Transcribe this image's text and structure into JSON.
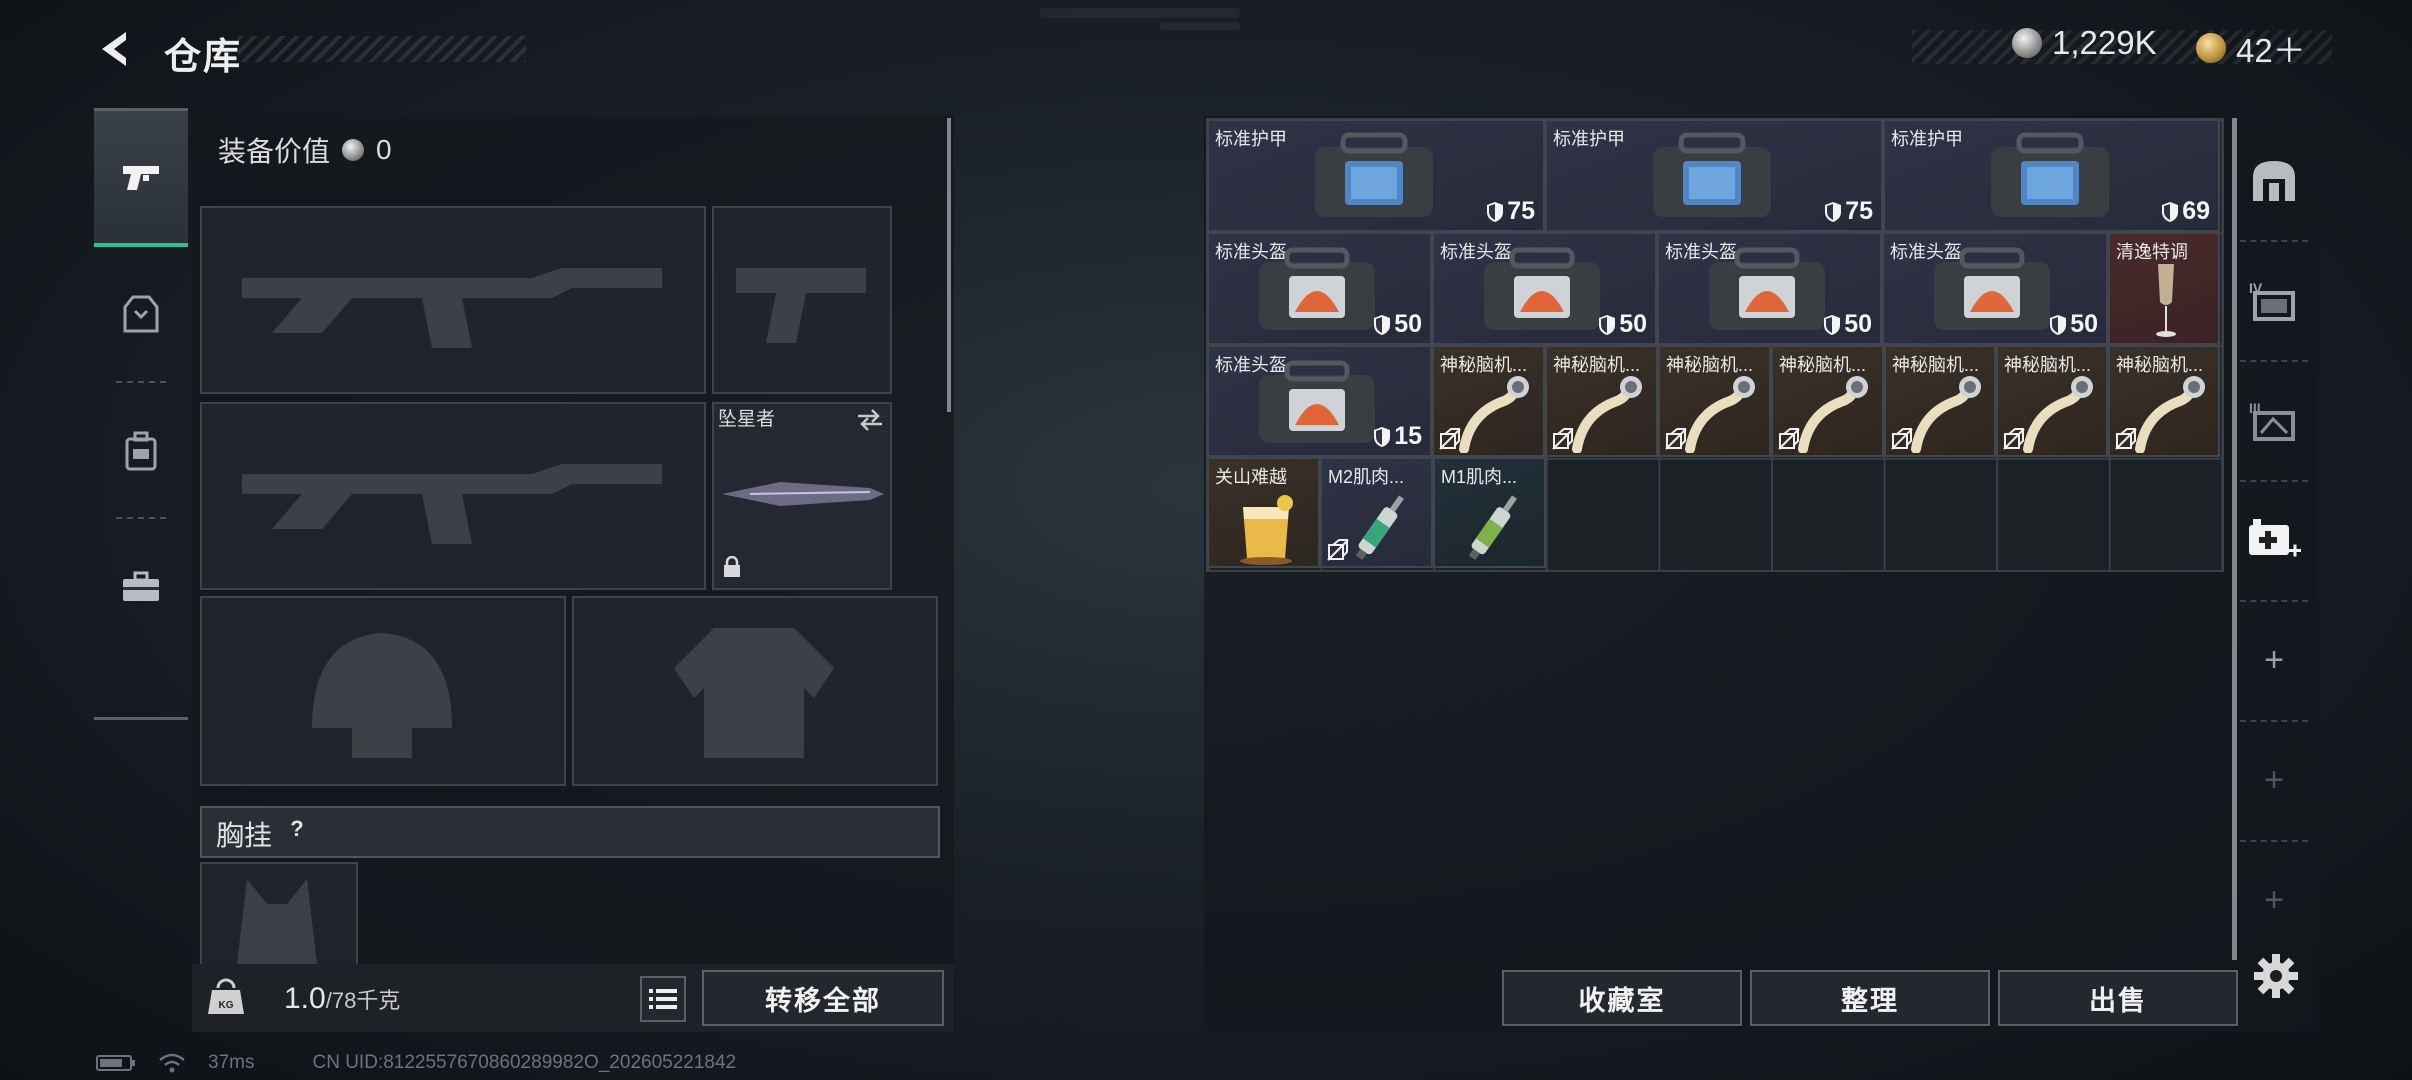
{
  "header": {
    "title": "仓库"
  },
  "currency": {
    "silver": "1,229K",
    "gold": "42＋"
  },
  "equipment": {
    "value_label": "装备价值",
    "value": "0",
    "melee_weapon_name": "坠星者",
    "chest_rig_label": "胸挂",
    "chest_rig_help": "?"
  },
  "footer_left": {
    "weight_value": "1.0",
    "weight_capacity": "/78千克",
    "transfer_all_label": "转移全部"
  },
  "stash": {
    "items": [
      {
        "name": "标准护甲",
        "durability": "75",
        "color": "blue",
        "type": "armor",
        "icon": "armor-bag-blue-icon"
      },
      {
        "name": "标准护甲",
        "durability": "75",
        "color": "blue",
        "type": "armor",
        "icon": "armor-bag-blue-icon"
      },
      {
        "name": "标准护甲",
        "durability": "69",
        "color": "blue",
        "type": "armor",
        "icon": "armor-bag-blue-icon"
      },
      {
        "name": "标准头盔",
        "durability": "50",
        "color": "blue",
        "type": "helmet",
        "icon": "helmet-bag-orange-icon"
      },
      {
        "name": "标准头盔",
        "durability": "50",
        "color": "blue",
        "type": "helmet",
        "icon": "helmet-bag-orange-icon"
      },
      {
        "name": "标准头盔",
        "durability": "50",
        "color": "blue",
        "type": "helmet",
        "icon": "helmet-bag-orange-icon"
      },
      {
        "name": "标准头盔",
        "durability": "50",
        "color": "blue",
        "type": "helmet",
        "icon": "helmet-bag-orange-icon"
      },
      {
        "name": "清逸特调",
        "durability": "",
        "color": "red",
        "type": "drink",
        "icon": "champagne-glass-icon"
      },
      {
        "name": "标准头盔",
        "durability": "15",
        "color": "blue",
        "type": "helmet",
        "icon": "helmet-bag-orange-icon"
      },
      {
        "name": "神秘脑机...",
        "color": "gold",
        "type": "bci",
        "icon": "brain-chip-icon"
      },
      {
        "name": "神秘脑机...",
        "color": "gold",
        "type": "bci",
        "icon": "brain-chip-icon"
      },
      {
        "name": "神秘脑机...",
        "color": "gold",
        "type": "bci",
        "icon": "brain-chip-icon"
      },
      {
        "name": "神秘脑机...",
        "color": "gold",
        "type": "bci",
        "icon": "brain-chip-icon"
      },
      {
        "name": "神秘脑机...",
        "color": "gold",
        "type": "bci",
        "icon": "brain-chip-icon"
      },
      {
        "name": "神秘脑机...",
        "color": "gold",
        "type": "bci",
        "icon": "brain-chip-icon"
      },
      {
        "name": "神秘脑机...",
        "color": "gold",
        "type": "bci",
        "icon": "brain-chip-icon"
      },
      {
        "name": "关山难越",
        "color": "gold",
        "type": "drink",
        "icon": "cocktail-glass-icon"
      },
      {
        "name": "M2肌肉...",
        "color": "blue",
        "type": "injector",
        "icon": "syringe-icon"
      },
      {
        "name": "M1肌肉...",
        "color": "teal",
        "type": "injector",
        "icon": "syringe-icon"
      }
    ]
  },
  "footer_right": {
    "collection_label": "收藏室",
    "sort_label": "整理",
    "sell_label": "出售"
  },
  "status_bar": {
    "ping": "37ms",
    "uid": "CN UID:8122557670860289982O_202605221842"
  },
  "colors": {
    "active_tab_accent": "#27c68c",
    "rarity_blue": "#2f3346",
    "rarity_gold": "#3a3128",
    "rarity_red": "#4a2a2c"
  }
}
